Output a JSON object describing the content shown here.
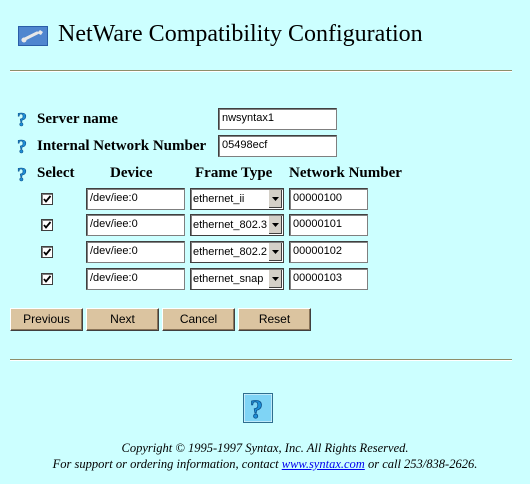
{
  "header": {
    "title": "NetWare Compatibility Configuration",
    "icon": "wrench-icon"
  },
  "form": {
    "server_name_label": "Server name",
    "server_name_value": "nwsyntax1",
    "network_number_label": "Internal Network Number",
    "network_number_value": "05498ecf"
  },
  "table": {
    "headers": [
      "Select",
      "Device",
      "Frame Type",
      "Network Number"
    ],
    "rows": [
      {
        "selected": true,
        "device": "/dev/iee:0",
        "frame_type": "ethernet_ii",
        "network_number": "00000100"
      },
      {
        "selected": true,
        "device": "/dev/iee:0",
        "frame_type": "ethernet_802.3",
        "network_number": "00000101"
      },
      {
        "selected": true,
        "device": "/dev/iee:0",
        "frame_type": "ethernet_802.2",
        "network_number": "00000102"
      },
      {
        "selected": true,
        "device": "/dev/iee:0",
        "frame_type": "ethernet_snap",
        "network_number": "00000103"
      }
    ]
  },
  "buttons": {
    "previous": "Previous",
    "next": "Next",
    "cancel": "Cancel",
    "reset": "Reset"
  },
  "footer": {
    "copyright": "Copyright © 1995-1997 Syntax, Inc. All Rights Reserved.",
    "support_prefix": "For support or ordering information, contact",
    "support_link": "www.syntax.com",
    "support_suffix": "or call 253/838-2626."
  },
  "colors": {
    "background": "#ccffff",
    "button": "#dbc4a0",
    "link": "#0000ee",
    "help_icon": "#1e90d8"
  }
}
